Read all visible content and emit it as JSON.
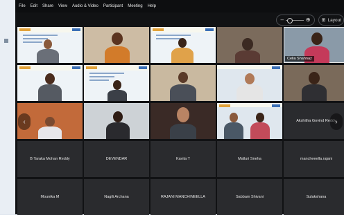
{
  "menu": [
    "File",
    "Edit",
    "Share",
    "View",
    "Audio & Video",
    "Participant",
    "Meeting",
    "Help"
  ],
  "toolbar": {
    "zoom_minus": "–",
    "zoom_plus": "⊕",
    "layout_label": "Layout"
  },
  "nav": {
    "prev": "‹",
    "next": "›"
  },
  "tiles": [
    {
      "id": "r1c1",
      "label": ""
    },
    {
      "id": "r1c2",
      "label": ""
    },
    {
      "id": "r1c3",
      "label": ""
    },
    {
      "id": "r1c4",
      "label": ""
    },
    {
      "id": "r1c5",
      "label": "Celia Shahnaz"
    },
    {
      "id": "r2c1",
      "label": ""
    },
    {
      "id": "r2c2",
      "label": ""
    },
    {
      "id": "r2c3",
      "label": ""
    },
    {
      "id": "r2c4",
      "label": ""
    },
    {
      "id": "r2c5",
      "label": ""
    },
    {
      "id": "r3c1",
      "label": ""
    },
    {
      "id": "r3c2",
      "label": ""
    },
    {
      "id": "r3c3",
      "label": ""
    },
    {
      "id": "r3c4",
      "label": ""
    },
    {
      "id": "r3c5",
      "label": "Akshitha Govind Reddy"
    }
  ],
  "names": [
    "B Taraka Mohan Reddy",
    "DEVENDAR",
    "Kavita T",
    "Malluri Sneha",
    "mancheeella.rajani",
    "Mounika M",
    "Nagili Archana",
    "RAJANI MANCHINEELLA",
    "Sabbam Shivani",
    "Sulakshana"
  ],
  "colors": {
    "window_bg": "#111214",
    "tile_bg": "#2a2b2e",
    "accent": "#e2a23a"
  }
}
